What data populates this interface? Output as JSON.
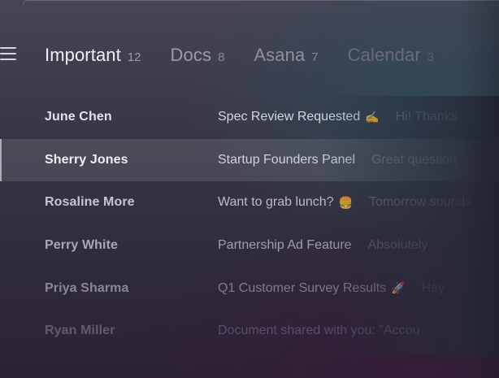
{
  "tabs": [
    {
      "label": "Important",
      "count": "12"
    },
    {
      "label": "Docs",
      "count": "8"
    },
    {
      "label": "Asana",
      "count": "7"
    },
    {
      "label": "Calendar",
      "count": "3"
    }
  ],
  "messages": [
    {
      "sender": "June Chen",
      "subject": "Spec Review Requested",
      "emoji": "✍️",
      "preview": "Hi! Thanks"
    },
    {
      "sender": "Sherry Jones",
      "subject": "Startup Founders Panel",
      "emoji": "",
      "preview": "Great question"
    },
    {
      "sender": "Rosaline More",
      "subject": "Want to grab lunch?",
      "emoji": "🍔",
      "preview": "Tomorrow sounds"
    },
    {
      "sender": "Perry White",
      "subject": "Partnership Ad Feature",
      "emoji": "",
      "preview": "Absolutely"
    },
    {
      "sender": "Priya Sharma",
      "subject": "Q1 Customer Survey Results",
      "emoji": "🚀",
      "preview": "Hey"
    },
    {
      "sender": "Ryan Miller",
      "subject": "Document shared with you: \"Accou",
      "emoji": "",
      "preview": ""
    }
  ],
  "selected_index": 1
}
